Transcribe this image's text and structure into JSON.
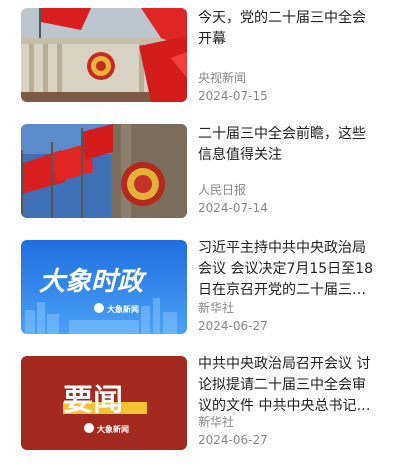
{
  "colors": {
    "title_text": "#222222",
    "meta_text": "#888888",
    "flag_red": "#d81e1e",
    "badge_gold": "#e8b53a",
    "banner_blue": "#2a7de8",
    "news_red": "#a42a1f"
  },
  "news": [
    {
      "title": "今天，党的二十届三中全会开幕",
      "source": "央视新闻",
      "date": "2024-07-15",
      "thumbnail_icon": "great-hall-flags-image"
    },
    {
      "title": "二十届三中全会前瞻，这些信息值得关注",
      "source": "人民日报",
      "date": "2024-07-14",
      "thumbnail_icon": "national-emblem-flags-image"
    },
    {
      "title": "习近平主持中共中央政治局会议 会议决定7月15日至18日在京召开党的二十届三…",
      "source": "新华社",
      "date": "2024-06-27",
      "thumbnail_icon": "daxiang-politics-banner",
      "thumb_text": "大象时政",
      "thumb_logo": "大象新闻"
    },
    {
      "title": "中共中央政治局召开会议 讨论拟提请二十届三中全会审议的文件 中共中央总书记…",
      "source": "新华社",
      "date": "2024-06-27",
      "thumbnail_icon": "important-news-banner",
      "thumb_text": "要闻",
      "thumb_logo": "大象新闻"
    }
  ]
}
